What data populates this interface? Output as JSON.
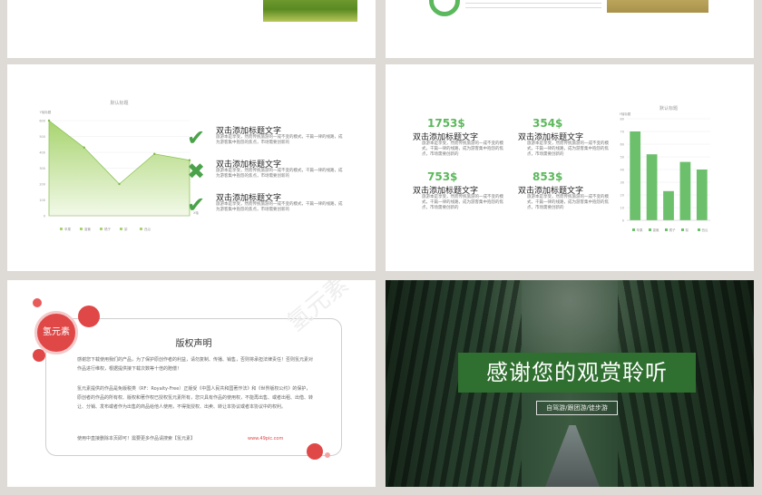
{
  "slide_chart_left": {
    "chart_title": "默认标题",
    "y_unit": "Y轴标题",
    "x_unit": "X轴",
    "items": [
      {
        "status": "check-icon",
        "title": "双击添加标题文字",
        "body": "旅游本是享受，然而传统旅游的一成不变的模式，千篇一律的线路，成为游客集中抱怨的焦点，市场需要创新的"
      },
      {
        "status": "cross-icon",
        "title": "双击添加标题文字",
        "body": "旅游本是享受，然而传统旅游的一成不变的模式，千篇一律的线路，成为游客集中抱怨的焦点，市场需要创新的"
      },
      {
        "status": "check-icon",
        "title": "双击添加标题文字",
        "body": "旅游本是享受，然而传统旅游的一成不变的模式，千篇一律的线路，成为游客集中抱怨的焦点，市场需要创新的"
      }
    ]
  },
  "slide_chart_right": {
    "chart_title": "默认标题",
    "y_unit": "Y轴标题",
    "stats": [
      {
        "value": "1753$",
        "title": "双击添加标题文字",
        "body": "旅游本是享受，然而传统旅游的一成不变的模式，千篇一律的线路，成为游客集中抱怨的焦点，市场需要创新的"
      },
      {
        "value": "354$",
        "title": "双击添加标题文字",
        "body": "旅游本是享受，然而传统旅游的一成不变的模式，千篇一律的线路，成为游客集中抱怨的焦点，市场需要创新的"
      },
      {
        "value": "753$",
        "title": "双击添加标题文字",
        "body": "旅游本是享受，然而传统旅游的一成不变的模式，千篇一律的线路，成为游客集中抱怨的焦点，市场需要创新的"
      },
      {
        "value": "853$",
        "title": "双击添加标题文字",
        "body": "旅游本是享受，然而传统旅游的一成不变的模式，千篇一律的线路，成为游客集中抱怨的焦点，市场需要创新的"
      }
    ]
  },
  "slide_copyright": {
    "badge": "氢元素",
    "title": "版权声明",
    "p1": "感谢您下载使用我们的产品，为了保护原创作者的利益，请勿复制、传播、销售，否则将承担法律责任！否则氢元素对作品进行维权，根据提供接下载次数等十倍的赔偿！",
    "p2": "氢元素提供的作品是免版税类（RF：Royalty-Free）正版受《中国人民共和国著作法》和《世界版权公约》的保护，原创者的作品的所有权、版权和著作权已授权氢元素所有，您只具有作品的使用权，不能再出售、或者出租、出借、转让、分销、发布或者作为出售的商品给他人使用，不得批授权、出卖、转让本协议或者本协议中的权利。",
    "footer": "使用中直接删除本页即可！需要更多作品请搜索【氢元素】",
    "link": "www.49pic.com",
    "watermark": "氢元素"
  },
  "slide_thanks": {
    "title": "感谢您的观赏聆听",
    "tagline": "自驾游/跟团游/徒步游"
  },
  "chart_data": [
    {
      "type": "area",
      "title": "默认标题",
      "ylabel": "Y轴标题",
      "xlabel": "X轴",
      "categories": [
        "苹果",
        "香蕉",
        "橘子",
        "梨",
        "西瓜"
      ],
      "values": [
        600,
        430,
        200,
        390,
        350
      ],
      "ylim": [
        0,
        600
      ],
      "yticks": [
        "0",
        "100",
        "200",
        "300",
        "400",
        "500",
        "600"
      ],
      "grid": true,
      "colors": [
        "#a8d46f",
        "#f2f9e8"
      ]
    },
    {
      "type": "bar",
      "title": "默认标题",
      "ylabel": "Y轴标题",
      "categories": [
        "苹果",
        "香蕉",
        "橘子",
        "梨",
        "西瓜"
      ],
      "values": [
        70,
        52,
        23,
        46,
        40
      ],
      "ylim": [
        0,
        80
      ],
      "yticks": [
        "0",
        "10",
        "20",
        "30",
        "40",
        "50",
        "60",
        "70",
        "80"
      ],
      "grid": true,
      "colors": [
        "#6cc06c"
      ]
    }
  ]
}
